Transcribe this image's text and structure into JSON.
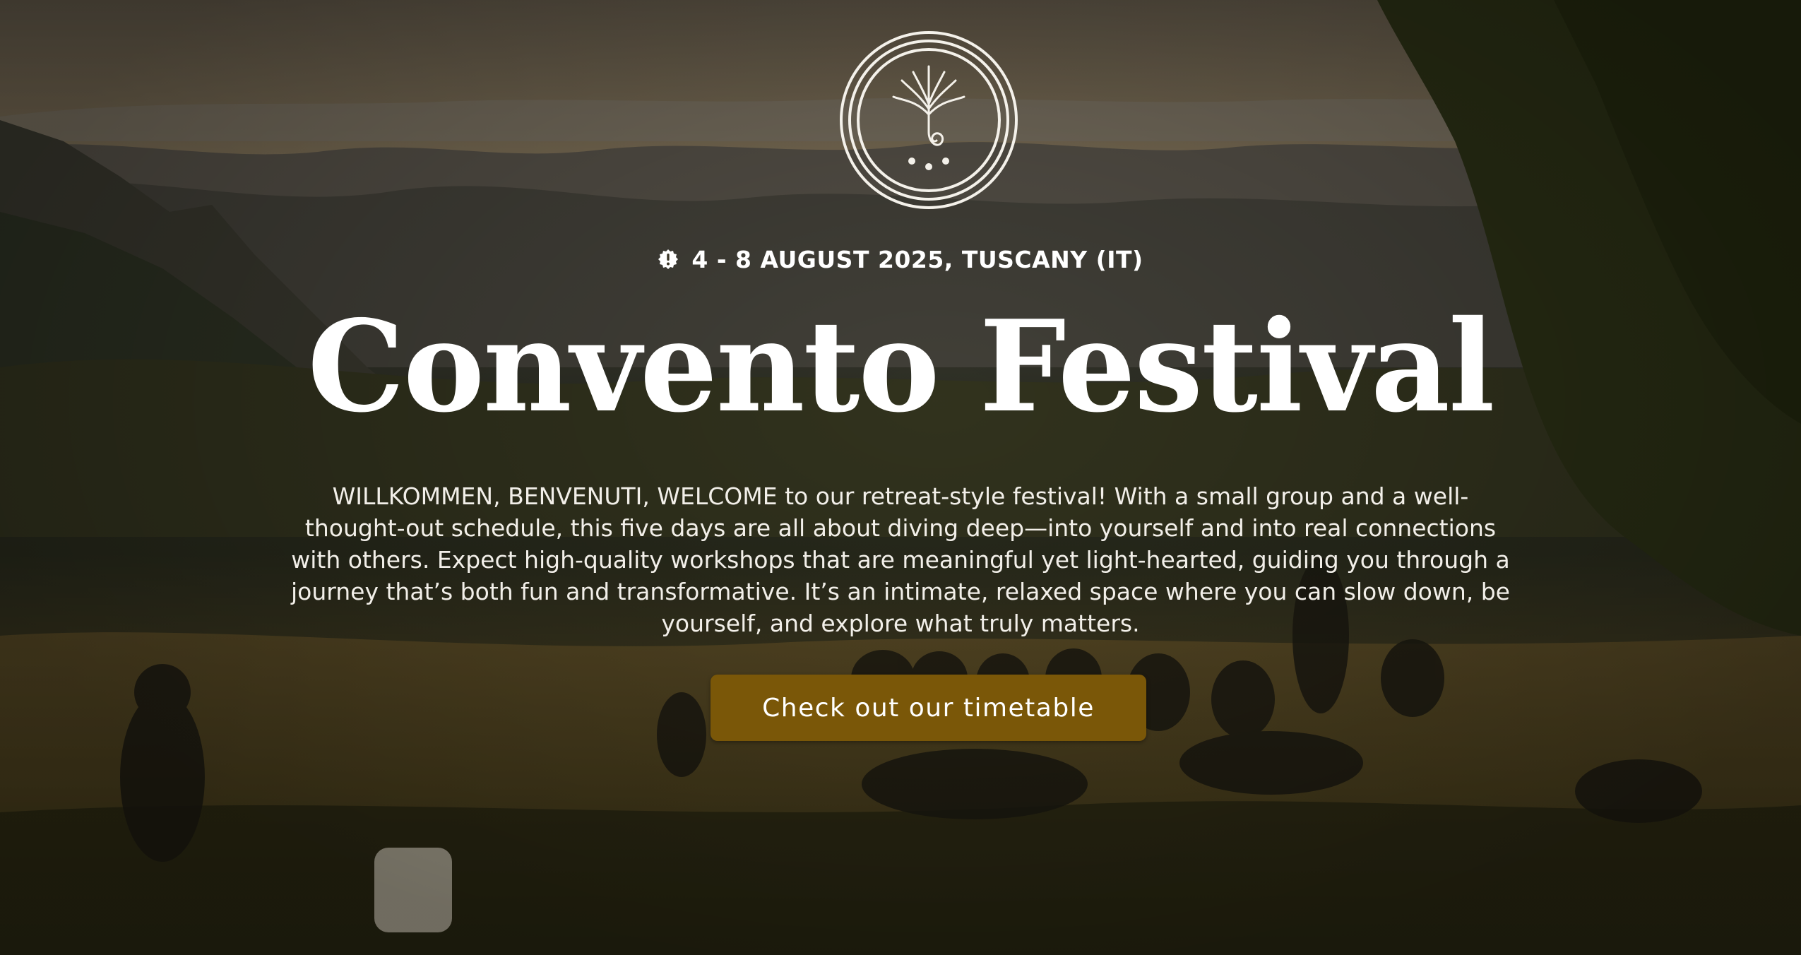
{
  "colors": {
    "accent": "#7a5708",
    "text": "#ffffff"
  },
  "logo": {
    "icon": "plant-spiral-emblem-icon"
  },
  "hero": {
    "date_icon": "alert-badge-icon",
    "dateline": "4 - 8 AUGUST 2025, TUSCANY (IT)",
    "title": "Convento Festival",
    "intro": "WILLKOMMEN, BENVENUTI, WELCOME to our retreat-style festival! With a small group and a well-thought-out schedule, this five days are all about diving deep—into yourself and into real connections with others. Expect high-quality workshops that are meaningful yet light-hearted, guiding you through a journey that’s both fun and transformative. It’s an intimate, relaxed space where you can slow down, be yourself, and explore what truly matters.",
    "cta_label": "Check out our timetable"
  }
}
